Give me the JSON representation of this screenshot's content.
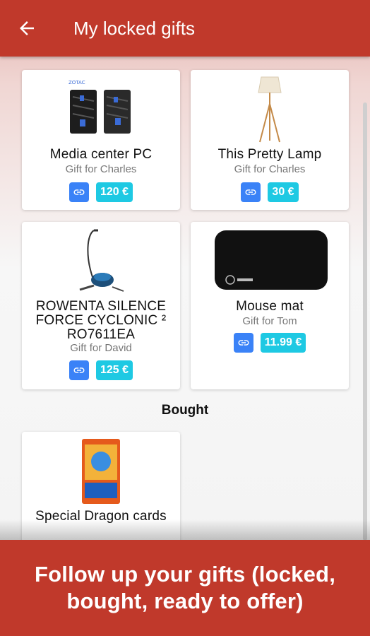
{
  "appbar": {
    "title": "My locked gifts"
  },
  "gifts": [
    {
      "name": "Media center PC",
      "for": "Gift for Charles",
      "price": "120 €"
    },
    {
      "name": "This Pretty Lamp",
      "for": "Gift for Charles",
      "price": "30 €"
    },
    {
      "name": "ROWENTA SILENCE FORCE CYCLONIC ² RO7611EA",
      "for": "Gift for David",
      "price": "125 €"
    },
    {
      "name": "Mouse mat",
      "for": "Gift for Tom",
      "price": "11.99 €"
    }
  ],
  "bought": {
    "title": "Bought",
    "items": [
      {
        "name": "Special Dragon cards"
      }
    ]
  },
  "banner": {
    "text": "Follow up your gifts (locked, bought, ready to offer)"
  },
  "colors": {
    "primary": "#c0392b",
    "link_button": "#3a82f7",
    "price_badge": "#1ec9e3"
  },
  "icons": {
    "back": "arrow-left-icon",
    "link": "link-icon"
  }
}
